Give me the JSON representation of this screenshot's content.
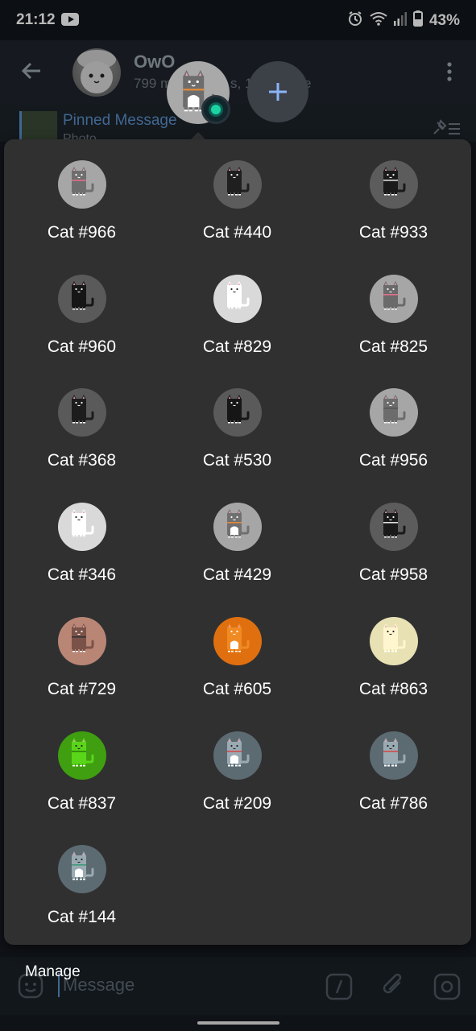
{
  "status_bar": {
    "time": "21:12",
    "battery": "43%"
  },
  "chat": {
    "title": "OwO",
    "subtitle_left": "799 m",
    "subtitle_mid": "s, 1",
    "subtitle_right": "e",
    "pinned_title": "Pinned Message",
    "pinned_subtitle": "Photo"
  },
  "composer": {
    "placeholder": "Message"
  },
  "manage_label": "Manage",
  "colors": {
    "accent": "#5b8fc9",
    "panel": "#303030",
    "status_dot": "#1cd3a2"
  },
  "selected_cat": {
    "body": "#6d6d6d",
    "bg": "#a9a9a9",
    "belly": "#ffffff",
    "collar": "#e08a3a"
  },
  "cats": [
    {
      "label": "Cat #966",
      "bg": "#a6a6a6",
      "body": "#6e6e6e",
      "belly": "",
      "collar": "#e16f8a"
    },
    {
      "label": "Cat #440",
      "bg": "#5c5c5c",
      "body": "#1f1f1f",
      "belly": "",
      "collar": ""
    },
    {
      "label": "Cat #933",
      "bg": "#5c5c5c",
      "body": "#1a1a1a",
      "belly": "",
      "collar": "#e0e0e0"
    },
    {
      "label": "Cat #960",
      "bg": "#5a5a5a",
      "body": "#161616",
      "belly": "",
      "collar": ""
    },
    {
      "label": "Cat #829",
      "bg": "#d9d9d9",
      "body": "#ffffff",
      "belly": "",
      "collar": ""
    },
    {
      "label": "Cat #825",
      "bg": "#a6a6a6",
      "body": "#6a6a6a",
      "belly": "",
      "collar": "#e16f8a"
    },
    {
      "label": "Cat #368",
      "bg": "#5a5a5a",
      "body": "#1c1c1c",
      "belly": "",
      "collar": ""
    },
    {
      "label": "Cat #530",
      "bg": "#5a5a5a",
      "body": "#161616",
      "belly": "",
      "collar": ""
    },
    {
      "label": "Cat #956",
      "bg": "#a6a6a6",
      "body": "#6c6c6c",
      "belly": "",
      "collar": "#555555"
    },
    {
      "label": "Cat #346",
      "bg": "#d9d9d9",
      "body": "#ffffff",
      "belly": "",
      "collar": ""
    },
    {
      "label": "Cat #429",
      "bg": "#a6a6a6",
      "body": "#707070",
      "belly": "#ffffff",
      "collar": "#e08a3a"
    },
    {
      "label": "Cat #958",
      "bg": "#5c5c5c",
      "body": "#1a1a1a",
      "belly": "",
      "collar": "#e0e0e0"
    },
    {
      "label": "Cat #729",
      "bg": "#b98676",
      "body": "#7a5248",
      "belly": "",
      "collar": "#333333"
    },
    {
      "label": "Cat #605",
      "bg": "#e0700f",
      "body": "#f08a22",
      "belly": "#ffffff",
      "collar": ""
    },
    {
      "label": "Cat #863",
      "bg": "#e8e1b4",
      "body": "#fff6d0",
      "belly": "",
      "collar": ""
    },
    {
      "label": "Cat #837",
      "bg": "#3f9f10",
      "body": "#5ad61a",
      "belly": "",
      "collar": "#2d7d0a"
    },
    {
      "label": "Cat #209",
      "bg": "#5c6a72",
      "body": "#9aaab3",
      "belly": "#ffffff",
      "collar": "#d64a4a"
    },
    {
      "label": "Cat #786",
      "bg": "#5c6a72",
      "body": "#9aaab3",
      "belly": "",
      "collar": "#d64a4a"
    },
    {
      "label": "Cat #144",
      "bg": "#5c6a72",
      "body": "#9aaab3",
      "belly": "#ffffff",
      "collar": "#3d9a7a"
    }
  ]
}
